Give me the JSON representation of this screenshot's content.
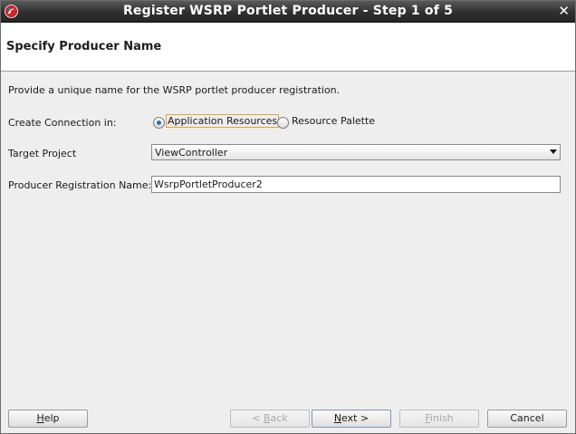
{
  "window": {
    "title": "Register WSRP Portlet Producer - Step 1 of 5",
    "close_glyph": "✕"
  },
  "header": {
    "title": "Specify Producer Name"
  },
  "form": {
    "description": "Provide a unique name for the WSRP portlet producer registration.",
    "create_connection": {
      "label": "Create Connection in:",
      "options": [
        {
          "label": "Application Resources",
          "selected": true
        },
        {
          "label": "Resource Palette",
          "selected": false
        }
      ]
    },
    "target_project": {
      "label": "Target Project",
      "value": "ViewController"
    },
    "producer_name": {
      "label": "Producer Registration Name:",
      "value": "WsrpPortletProducer2"
    }
  },
  "buttons": {
    "help": {
      "mnemonic": "H",
      "rest": "elp",
      "enabled": true
    },
    "back": {
      "prefix": "< ",
      "mnemonic": "B",
      "rest": "ack",
      "enabled": false
    },
    "next": {
      "mnemonic": "N",
      "rest": "ext >",
      "enabled": true
    },
    "finish": {
      "mnemonic": "F",
      "rest": "inish",
      "enabled": false
    },
    "cancel": {
      "label": "Cancel",
      "enabled": true
    }
  },
  "colors": {
    "titlebar": "#2f2f2f",
    "focus_border": "#e3a23b",
    "radio_dot": "#3d6fa8"
  },
  "icons": {
    "app": "oracle-jdeveloper-icon",
    "close": "close-icon",
    "dropdown": "chevron-down-icon"
  }
}
